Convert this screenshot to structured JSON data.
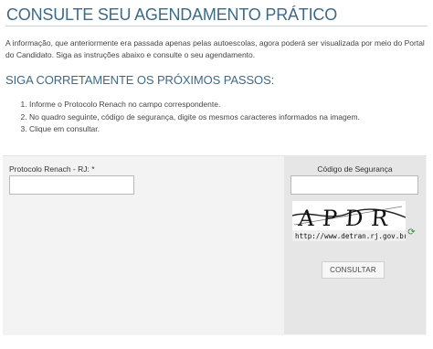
{
  "page": {
    "title": "CONSULTE SEU AGENDAMENTO PRÁTICO",
    "intro": "A informação, que anteriormente era passada apenas pelas autoescolas, agora poderá ser visualizada por meio do Portal do Candidato. Siga as instruções abaixo e consulte o seu agendamento.",
    "subtitle": "SIGA CORRETAMENTE OS PRÓXIMOS PASSOS:",
    "steps": [
      "Informe o Protocolo Renach no campo correspondente.",
      "No quadro seguinte, código de segurança, digite os mesmos caracteres informados na imagem.",
      "Clique em consultar."
    ]
  },
  "form": {
    "protocolo_label": "Protocolo Renach - RJ: *",
    "protocolo_value": "",
    "codigo_label": "Código de Segurança",
    "codigo_value": "",
    "captcha_text": "APDR",
    "captcha_url": "http://www.detran.rj.gov.br",
    "refresh_icon": "refresh-icon",
    "submit_label": "CONSULTAR"
  },
  "colors": {
    "heading": "#3d6a86",
    "panel": "#f3f3f3",
    "panel_right": "#e6e6e6"
  }
}
